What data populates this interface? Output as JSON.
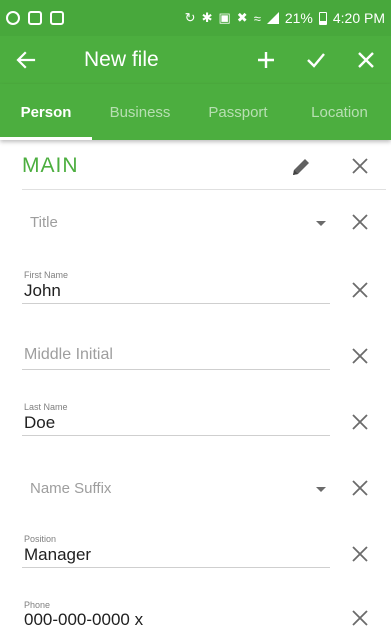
{
  "status_bar": {
    "battery_percent": "21%",
    "time": "4:20 PM"
  },
  "toolbar": {
    "title": "New file",
    "back_icon": "arrow-left-icon",
    "add_icon": "plus-icon",
    "save_icon": "check-icon",
    "close_icon": "close-icon"
  },
  "tabs": [
    {
      "label": "Person",
      "active": true
    },
    {
      "label": "Business",
      "active": false
    },
    {
      "label": "Passport",
      "active": false
    },
    {
      "label": "Location",
      "active": false
    }
  ],
  "section": {
    "title": "MAIN",
    "edit_icon": "pencil-icon",
    "close_icon": "close-icon"
  },
  "fields": {
    "title": {
      "placeholder": "Title"
    },
    "first_name": {
      "label": "First Name",
      "value": "John"
    },
    "middle_initial": {
      "placeholder": "Middle Initial"
    },
    "last_name": {
      "label": "Last Name",
      "value": "Doe"
    },
    "name_suffix": {
      "placeholder": "Name Suffix"
    },
    "position": {
      "label": "Position",
      "value": "Manager"
    },
    "phone": {
      "label": "Phone",
      "value": "000-000-0000 x"
    }
  },
  "colors": {
    "accent": "#4cae3f",
    "status_bar": "#48a83c",
    "text": "#202020",
    "placeholder": "#9e9e9e"
  }
}
